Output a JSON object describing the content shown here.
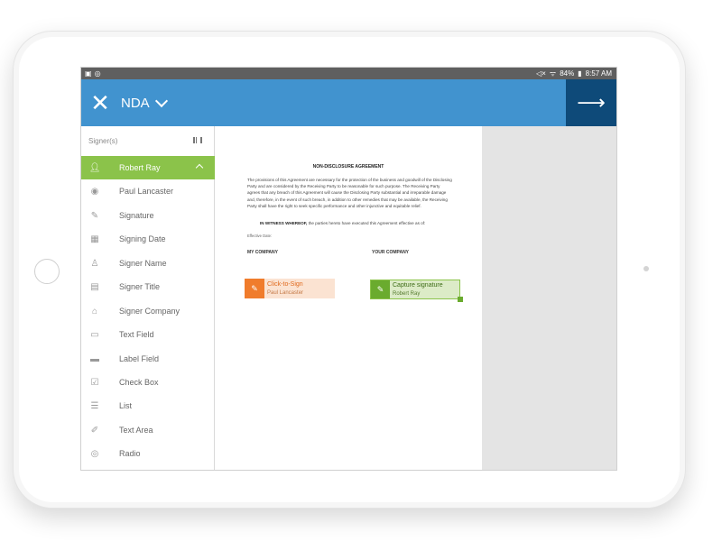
{
  "status_bar": {
    "left_icons": [
      "image-icon",
      "sync-icon"
    ],
    "battery": "84%",
    "time": "8:57 AM"
  },
  "header": {
    "document_name": "NDA"
  },
  "sidebar": {
    "signers_label": "Signer(s)",
    "items": [
      {
        "label": "Robert Ray",
        "icon": "user-icon",
        "active": true
      },
      {
        "label": "Paul Lancaster",
        "icon": "user-circle-icon"
      },
      {
        "label": "Signature",
        "icon": "pen-icon"
      },
      {
        "label": "Signing Date",
        "icon": "calendar-icon"
      },
      {
        "label": "Signer Name",
        "icon": "person-icon"
      },
      {
        "label": "Signer Title",
        "icon": "id-card-icon"
      },
      {
        "label": "Signer Company",
        "icon": "building-icon"
      },
      {
        "label": "Text Field",
        "icon": "text-field-icon"
      },
      {
        "label": "Label Field",
        "icon": "label-field-icon"
      },
      {
        "label": "Check Box",
        "icon": "checkbox-icon"
      },
      {
        "label": "List",
        "icon": "list-icon"
      },
      {
        "label": "Text Area",
        "icon": "text-area-icon"
      },
      {
        "label": "Radio",
        "icon": "radio-icon"
      }
    ]
  },
  "document": {
    "heading": "NON-DISCLOSURE AGREEMENT",
    "body": "The provisions of this Agreement are necessary for the protection of the business and goodwill of the Disclosing Party and are considered by the Receiving Party to be reasonable for such purpose. The Receiving Party agrees that any breach of this Agreement will cause the Disclosing Party substantial and irreparable damage and, therefore, in the event of such breach, in addition to other remedies that may be available, the Receiving Party shall have the right to seek specific performance and other injunctive and equitable relief.",
    "witness_bold": "IN WITNESS WHEREOF,",
    "witness_rest": " the parties hereto have executed this Agreement effective as of:",
    "effective_date": "Effective Date:",
    "col_my_company": "MY COMPANY",
    "col_your_company": "YOUR COMPANY",
    "field_click_to_sign": {
      "title": "Click-to-Sign",
      "signer": "Paul Lancaster",
      "color": "#f07c2c"
    },
    "field_capture": {
      "title": "Capture signature",
      "signer": "Robert Ray",
      "color": "#6aab2e"
    }
  },
  "colors": {
    "topbar": "#4193cf",
    "next_button": "#0e4a79",
    "active_signer": "#8bc34a"
  }
}
